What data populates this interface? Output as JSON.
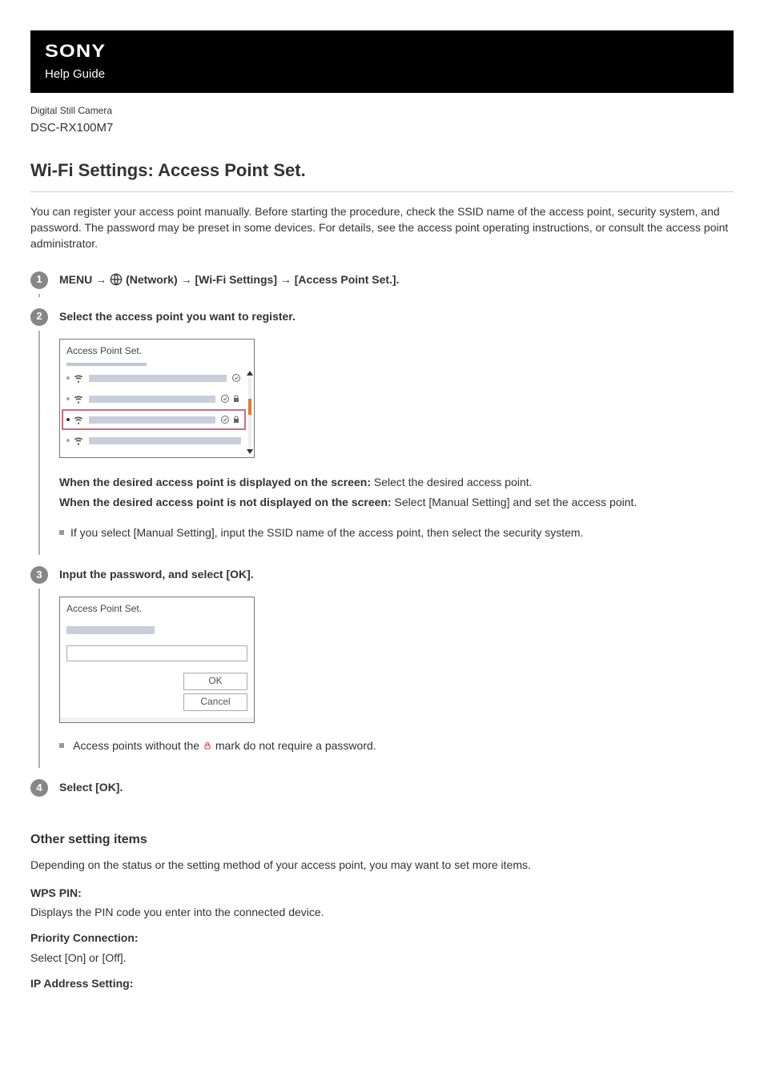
{
  "brand": "SONY",
  "help_guide": "Help Guide",
  "product_line": "Digital Still Camera",
  "model": "DSC-RX100M7",
  "title": "Wi-Fi Settings: Access Point Set.",
  "intro": "You can register your access point manually. Before starting the procedure, check the SSID name of the access point, security system, and password. The password may be preset in some devices. For details, see the access point operating instructions, or consult the access point administrator.",
  "steps": {
    "s1": {
      "pre": "MENU →",
      "post": "(Network) → [Wi-Fi Settings] → [Access Point Set.]."
    },
    "s2": {
      "heading": "Select the access point you want to register.",
      "screenshot_title": "Access Point Set.",
      "case1_label": "When the desired access point is displayed on the screen:",
      "case1_text": " Select the desired access point.",
      "case2_label": "When the desired access point is not displayed on the screen:",
      "case2_text": " Select [Manual Setting] and set the access point.",
      "bullet": "If you select [Manual Setting], input the SSID name of the access point, then select the security system."
    },
    "s3": {
      "heading": "Input the password, and select [OK].",
      "screenshot_title": "Access Point Set.",
      "btn_ok": "OK",
      "btn_cancel": "Cancel",
      "bullet_pre": "Access points without the ",
      "bullet_post": " mark do not require a password."
    },
    "s4": {
      "heading": "Select [OK]."
    }
  },
  "other_heading": "Other setting items",
  "other_intro": "Depending on the status or the setting method of your access point, you may want to set more items.",
  "items": {
    "wps_pin_t": "WPS PIN:",
    "wps_pin_d": "Displays the PIN code you enter into the connected device.",
    "priority_t": "Priority Connection:",
    "priority_d": "Select [On] or [Off].",
    "ip_t": "IP Address Setting:"
  }
}
